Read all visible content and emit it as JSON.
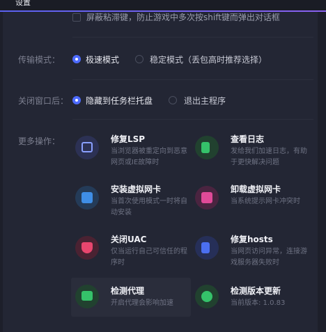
{
  "window": {
    "title": "设置"
  },
  "shift_option": {
    "label": "屏蔽粘滞键，防止游戏中多次按shift键而弹出对话框",
    "checked": false
  },
  "transfer": {
    "label": "传输模式：",
    "options": [
      {
        "label": "极速模式",
        "selected": true
      },
      {
        "label": "稳定模式（丢包高时推荐选择）",
        "selected": false
      }
    ]
  },
  "close_window": {
    "label": "关闭窗口后：",
    "options": [
      {
        "label": "隐藏到任务栏托盘",
        "selected": true
      },
      {
        "label": "退出主程序",
        "selected": false
      }
    ]
  },
  "more_ops": {
    "label": "更多操作：",
    "items": [
      {
        "title": "修复LSP",
        "desc": "当浏览器被重定向到恶意网页或IE故障时",
        "icon": "browser-repair-icon",
        "color": "#3a4da8"
      },
      {
        "title": "查看日志",
        "desc": "发给我们加速日志，有助于更快解决问题",
        "icon": "log-icon",
        "color": "#2e8a4b"
      },
      {
        "title": "安装虚拟网卡",
        "desc": "当首次使用模式一时将自动安装",
        "icon": "install-nic-icon",
        "color": "#2f6fb0"
      },
      {
        "title": "卸载虚拟网卡",
        "desc": "当系统提示网卡冲突时",
        "icon": "uninstall-nic-icon",
        "color": "#b03a78"
      },
      {
        "title": "关闭UAC",
        "desc": "仅当运行自己可信任的程序时",
        "icon": "uac-shield-icon",
        "color": "#c4385a"
      },
      {
        "title": "修复hosts",
        "desc": "当网页访问异常，连接游戏服务器失败时",
        "icon": "hosts-repair-icon",
        "color": "#3a55c0"
      },
      {
        "title": "检测代理",
        "desc": "开启代理会影响加速",
        "icon": "proxy-check-icon",
        "color": "#2e8a4b"
      },
      {
        "title": "检测版本更新",
        "desc": "当前版本: 1.0.83",
        "icon": "update-check-icon",
        "color": "#2e9a5e"
      }
    ]
  }
}
